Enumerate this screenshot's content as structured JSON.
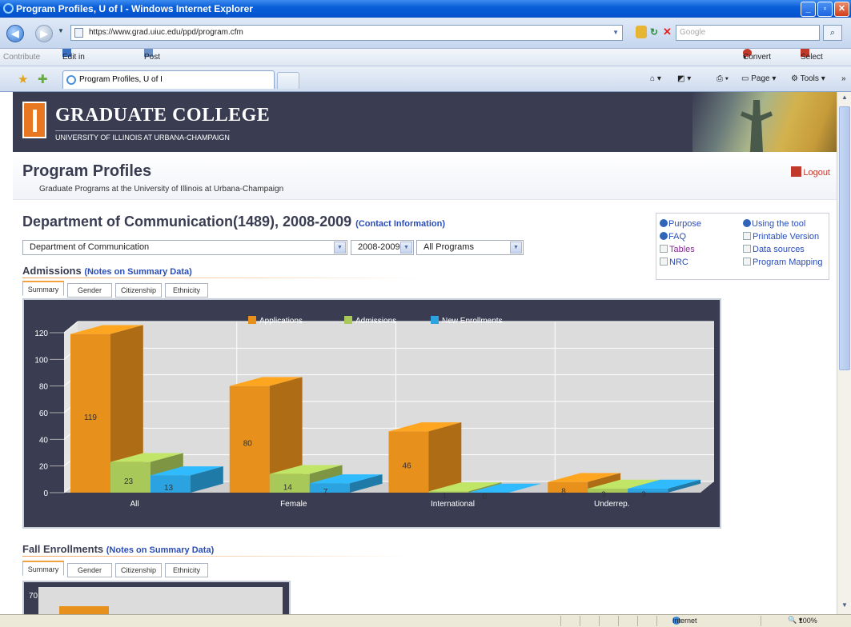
{
  "window": {
    "title": "Program Profiles, U of I - Windows Internet Explorer"
  },
  "browser": {
    "url": "https://www.grad.uiuc.edu/ppd/program.cfm",
    "search_placeholder": "Google",
    "links": {
      "contribute": "Contribute",
      "edit": "Edit in Contribute",
      "post": "Post to Blog",
      "convert": "Convert",
      "select": "Select"
    },
    "tab_title": "Program Profiles, U of I",
    "tools": {
      "page": "Page",
      "tools": "Tools"
    }
  },
  "banner": {
    "title": "GRADUATE COLLEGE",
    "subtitle": "UNIVERSITY OF ILLINOIS AT URBANA-CHAMPAIGN"
  },
  "header": {
    "title": "Program Profiles",
    "subtitle": "Graduate Programs at the University of Illinois at Urbana-Champaign",
    "logout": "Logout"
  },
  "dept": {
    "title": "Department of Communication(1489), 2008-2009",
    "contact": "(Contact Information)"
  },
  "filters": {
    "department": "Department of Communication",
    "year": "2008-2009",
    "program": "All Programs"
  },
  "sidebox": {
    "purpose": "Purpose",
    "using": "Using the tool",
    "faq": "FAQ",
    "printable": "Printable Version",
    "tables": "Tables",
    "sources": "Data sources",
    "nrc": "NRC",
    "mapping": "Program Mapping"
  },
  "admissions": {
    "title": "Admissions",
    "note": "(Notes on Summary Data)"
  },
  "fall": {
    "title": "Fall Enrollments",
    "note": "(Notes on Summary Data)"
  },
  "subtabs": [
    "Summary",
    "Gender",
    "Citizenship",
    "Ethnicity"
  ],
  "chart_data": [
    {
      "type": "bar",
      "categories": [
        "All",
        "Female",
        "International",
        "Underrep."
      ],
      "series": [
        {
          "name": "Applications",
          "values": [
            119,
            80,
            46,
            8
          ],
          "color": "#e8901c"
        },
        {
          "name": "Admissions",
          "values": [
            23,
            14,
            1,
            3
          ],
          "color": "#a8c85a"
        },
        {
          "name": "New Enrollments",
          "values": [
            13,
            7,
            0,
            3
          ],
          "color": "#2aa3e0"
        }
      ],
      "yticks": [
        "0",
        "20",
        "40",
        "60",
        "80",
        "100",
        "120"
      ],
      "ylim": [
        0,
        120
      ],
      "legend": "top-center",
      "grid": true
    },
    {
      "type": "bar",
      "yticks": [
        "70"
      ]
    }
  ],
  "status": {
    "zone": "Internet",
    "zoom": "100%"
  }
}
